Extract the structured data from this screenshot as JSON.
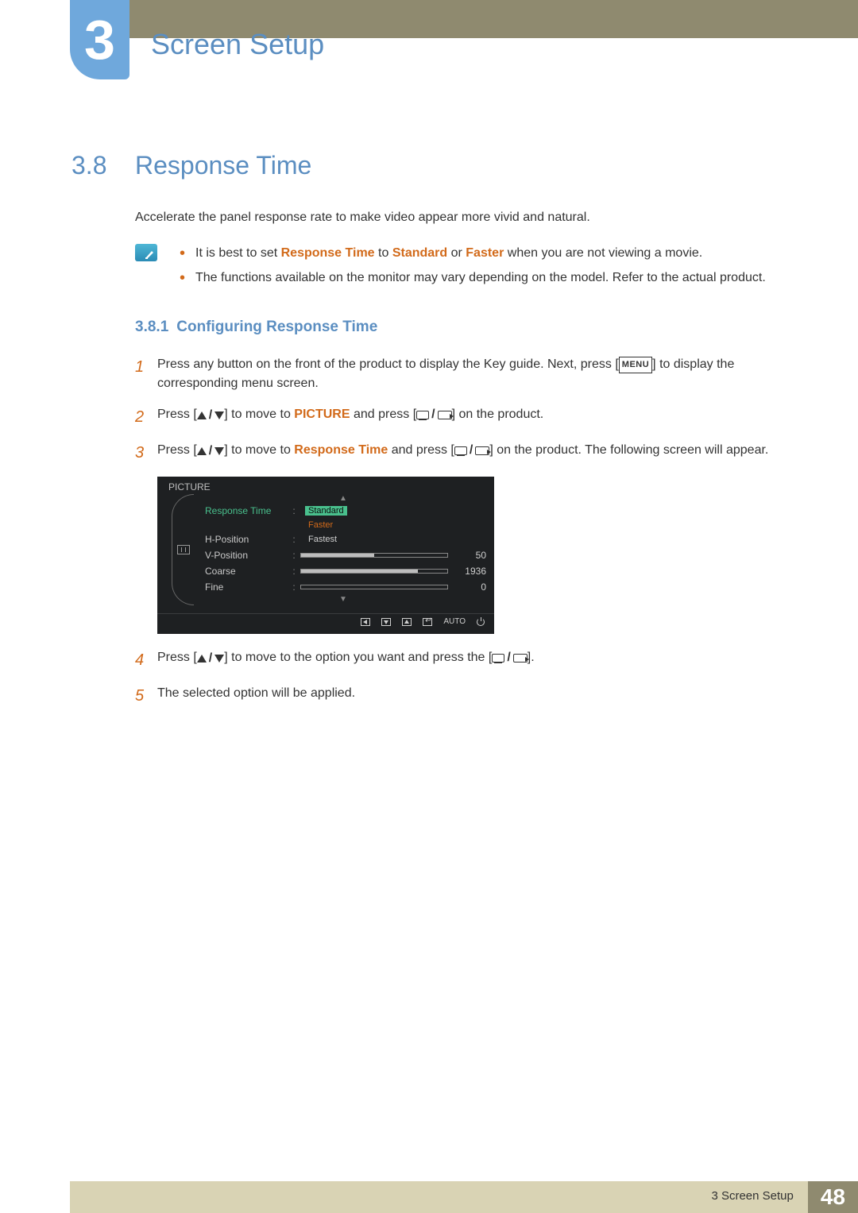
{
  "chapter": {
    "number": "3",
    "title": "Screen Setup"
  },
  "section": {
    "number": "3.8",
    "title": "Response Time"
  },
  "intro": "Accelerate the panel response rate to make video appear more vivid and natural.",
  "notes": {
    "n1_a": "It is best to set ",
    "n1_rt": "Response Time",
    "n1_b": " to ",
    "n1_std": "Standard",
    "n1_c": " or ",
    "n1_fast": "Faster",
    "n1_d": " when you are not viewing a movie.",
    "n2": "The functions available on the monitor may vary depending on the model. Refer to the actual product."
  },
  "subsection": {
    "number": "3.8.1",
    "title": "Configuring Response Time"
  },
  "steps": {
    "s1_a": "Press any button on the front of the product to display the Key guide. Next, press [",
    "s1_menu": "MENU",
    "s1_b": "] to display the corresponding menu screen.",
    "s2_a": "Press [",
    "s2_b": "] to move to ",
    "s2_pic": "PICTURE",
    "s2_c": " and press [",
    "s2_d": "] on the product.",
    "s3_a": "Press [",
    "s3_b": "] to move to ",
    "s3_rt": "Response Time",
    "s3_c": " and press [",
    "s3_d": "] on the product. The following screen will appear.",
    "s4_a": "Press [",
    "s4_b": "] to move to the option you want and press the [",
    "s4_c": "].",
    "s5": "The selected option will be applied."
  },
  "osd": {
    "title": "PICTURE",
    "rows": {
      "r1": "Response Time",
      "r2": "H-Position",
      "r3": "V-Position",
      "r4": "Coarse",
      "r5": "Fine"
    },
    "opts": {
      "o1": "Standard",
      "o2": "Faster",
      "o3": "Fastest"
    },
    "vals": {
      "v3": "50",
      "v4": "1936",
      "v5": "0"
    },
    "auto": "AUTO"
  },
  "footer": {
    "text": "3 Screen Setup",
    "page": "48"
  }
}
